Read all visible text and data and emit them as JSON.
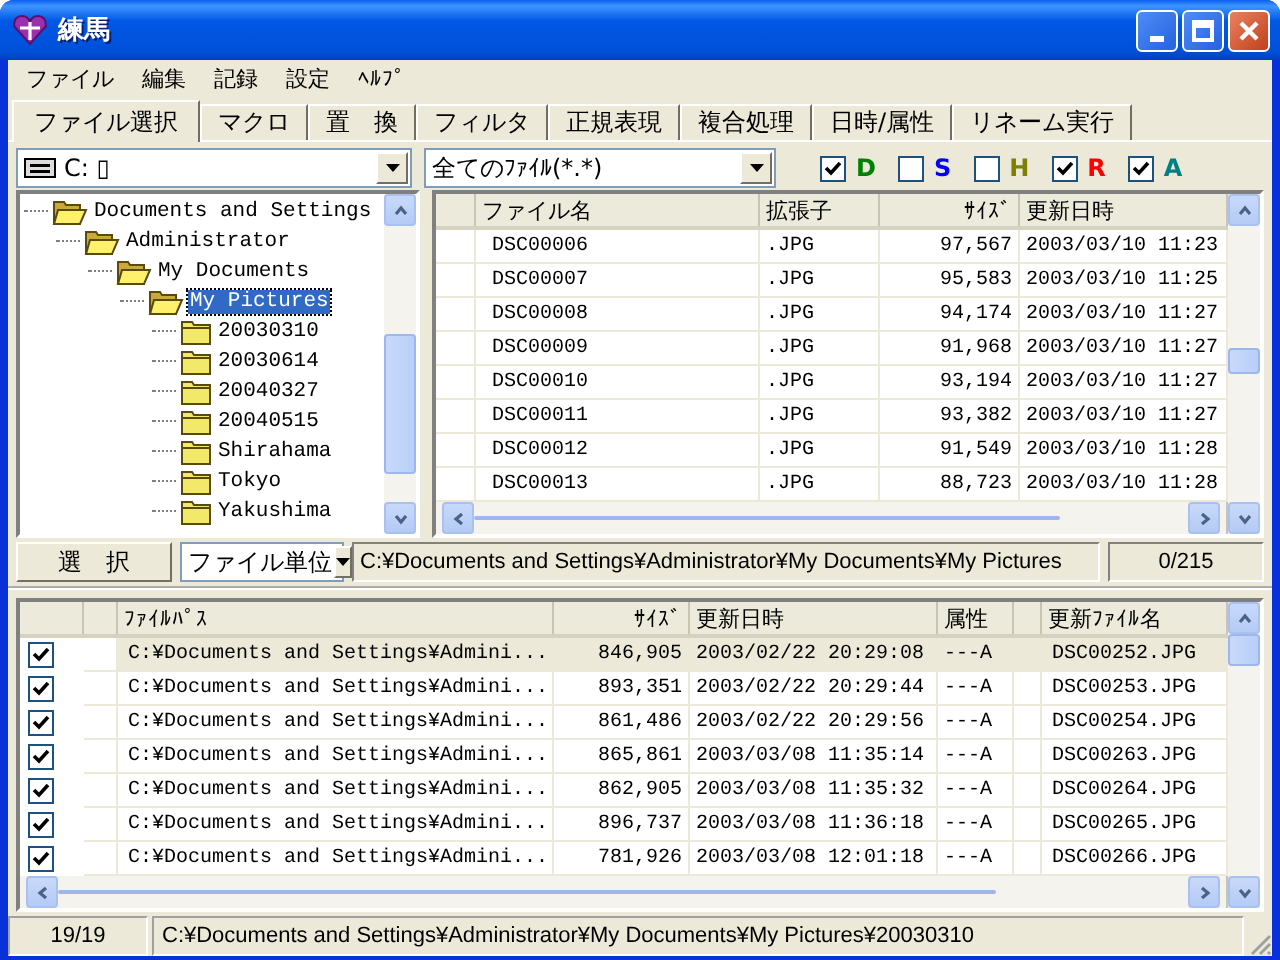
{
  "window": {
    "title": "練馬"
  },
  "menu": [
    "ファイル",
    "編集",
    "記録",
    "設定",
    "ﾍﾙﾌﾟ"
  ],
  "tabs": [
    {
      "label": "ファイル選択",
      "selected": true
    },
    {
      "label": "マクロ",
      "selected": false
    },
    {
      "label": "置　換",
      "selected": false
    },
    {
      "label": "フィルタ",
      "selected": false
    },
    {
      "label": "正規表現",
      "selected": false
    },
    {
      "label": "複合処理",
      "selected": false
    },
    {
      "label": "日時/属性",
      "selected": false
    },
    {
      "label": "リネーム実行",
      "selected": false
    }
  ],
  "drive": {
    "value": "C: ▯"
  },
  "filter": {
    "value": "全てのﾌｧｲﾙ(*.*)"
  },
  "attributes": [
    {
      "label": "D",
      "checked": true,
      "color": "#008000"
    },
    {
      "label": "S",
      "checked": false,
      "color": "#0000ff"
    },
    {
      "label": "H",
      "checked": false,
      "color": "#808000"
    },
    {
      "label": "R",
      "checked": true,
      "color": "#ff0000"
    },
    {
      "label": "A",
      "checked": true,
      "color": "#008080"
    }
  ],
  "tree": [
    {
      "label": "Documents and Settings",
      "selected": false,
      "children": [
        {
          "label": "Administrator",
          "selected": false,
          "children": [
            {
              "label": "My Documents",
              "selected": false,
              "children": [
                {
                  "label": "My Pictures",
                  "selected": true,
                  "children": [
                    {
                      "label": "20030310",
                      "selected": false
                    },
                    {
                      "label": "20030614",
                      "selected": false
                    },
                    {
                      "label": "20040327",
                      "selected": false
                    },
                    {
                      "label": "20040515",
                      "selected": false
                    },
                    {
                      "label": "Shirahama",
                      "selected": false
                    },
                    {
                      "label": "Tokyo",
                      "selected": false
                    },
                    {
                      "label": "Yakushima",
                      "selected": false
                    }
                  ]
                }
              ]
            }
          ]
        }
      ]
    }
  ],
  "files": {
    "columns": [
      "ファイル名",
      "拡張子",
      "ｻｲｽﾞ",
      "更新日時"
    ],
    "rows": [
      [
        "DSC00006",
        ".JPG",
        "97,567",
        "2003/03/10 11:23"
      ],
      [
        "DSC00007",
        ".JPG",
        "95,583",
        "2003/03/10 11:25"
      ],
      [
        "DSC00008",
        ".JPG",
        "94,174",
        "2003/03/10 11:27"
      ],
      [
        "DSC00009",
        ".JPG",
        "91,968",
        "2003/03/10 11:27"
      ],
      [
        "DSC00010",
        ".JPG",
        "93,194",
        "2003/03/10 11:27"
      ],
      [
        "DSC00011",
        ".JPG",
        "93,382",
        "2003/03/10 11:27"
      ],
      [
        "DSC00012",
        ".JPG",
        "91,549",
        "2003/03/10 11:28"
      ],
      [
        "DSC00013",
        ".JPG",
        "88,723",
        "2003/03/10 11:28"
      ]
    ]
  },
  "select_button": "選　択",
  "unit": {
    "value": "ファイル単位"
  },
  "current_path": "C:¥Documents and Settings¥Administrator¥My Documents¥My Pictures",
  "selected_count": "0/215",
  "queue": {
    "columns": [
      "ﾌｧｲﾙﾊﾟｽ",
      "ｻｲｽﾞ",
      "更新日時",
      "属性",
      "更新ﾌｧｲﾙ名"
    ],
    "rows": [
      {
        "checked": true,
        "selected": true,
        "cells": [
          "C:¥Documents and Settings¥Admini...",
          "846,905",
          "2003/02/22 20:29:08",
          "---A",
          "DSC00252.JPG"
        ]
      },
      {
        "checked": true,
        "selected": false,
        "cells": [
          "C:¥Documents and Settings¥Admini...",
          "893,351",
          "2003/02/22 20:29:44",
          "---A",
          "DSC00253.JPG"
        ]
      },
      {
        "checked": true,
        "selected": false,
        "cells": [
          "C:¥Documents and Settings¥Admini...",
          "861,486",
          "2003/02/22 20:29:56",
          "---A",
          "DSC00254.JPG"
        ]
      },
      {
        "checked": true,
        "selected": false,
        "cells": [
          "C:¥Documents and Settings¥Admini...",
          "865,861",
          "2003/03/08 11:35:14",
          "---A",
          "DSC00263.JPG"
        ]
      },
      {
        "checked": true,
        "selected": false,
        "cells": [
          "C:¥Documents and Settings¥Admini...",
          "862,905",
          "2003/03/08 11:35:32",
          "---A",
          "DSC00264.JPG"
        ]
      },
      {
        "checked": true,
        "selected": false,
        "cells": [
          "C:¥Documents and Settings¥Admini...",
          "896,737",
          "2003/03/08 11:36:18",
          "---A",
          "DSC00265.JPG"
        ]
      },
      {
        "checked": true,
        "selected": false,
        "cells": [
          "C:¥Documents and Settings¥Admini...",
          "781,926",
          "2003/03/08 12:01:18",
          "---A",
          "DSC00266.JPG"
        ]
      }
    ]
  },
  "status_bar": {
    "count": "19/19",
    "path": "C:¥Documents and Settings¥Administrator¥My Documents¥My Pictures¥20030310"
  }
}
